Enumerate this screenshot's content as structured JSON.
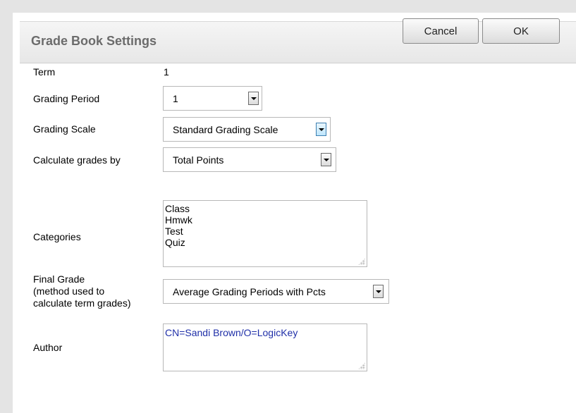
{
  "dialog": {
    "title": "Grade Book Settings",
    "cancel_label": "Cancel",
    "ok_label": "OK"
  },
  "fields": {
    "term": {
      "label": "Term",
      "value": "1"
    },
    "grading_period": {
      "label": "Grading Period",
      "value": "1"
    },
    "grading_scale": {
      "label": "Grading Scale",
      "value": "Standard Grading Scale"
    },
    "calculate_by": {
      "label": "Calculate grades by",
      "value": "Total Points"
    },
    "categories": {
      "label": "Categories",
      "items": [
        "Class",
        "Hmwk",
        "Test",
        "Quiz"
      ]
    },
    "final_grade": {
      "label_line1": "Final Grade",
      "label_line2": "(method used to",
      "label_line3": "calculate term grades)",
      "value": "Average Grading Periods with Pcts"
    },
    "author": {
      "label": "Author",
      "value": "CN=Sandi Brown/O=LogicKey"
    }
  },
  "colors": {
    "author_text": "#1f2fa8",
    "focused_arrow": "#3c7fb1"
  }
}
